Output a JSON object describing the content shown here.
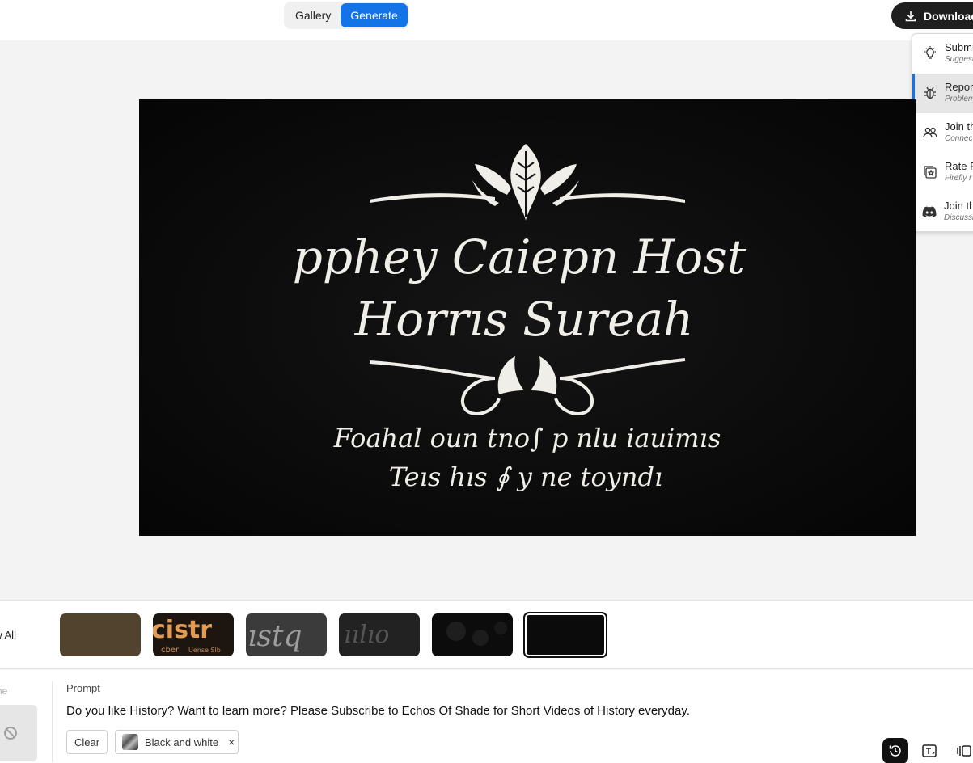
{
  "topbar": {
    "tabs": [
      {
        "label": "Gallery",
        "active": false
      },
      {
        "label": "Generate",
        "active": true
      }
    ],
    "download_label": "Download"
  },
  "menu": {
    "items": [
      {
        "title": "Submi",
        "subtitle": "Suggest",
        "icon": "lightbulb-icon"
      },
      {
        "title": "Repor",
        "subtitle": "Problem",
        "icon": "bug-icon"
      },
      {
        "title": "Join th",
        "subtitle": "Connec",
        "icon": "community-icon"
      },
      {
        "title": "Rate F",
        "subtitle": "Firefly r",
        "icon": "star-badge-icon"
      },
      {
        "title": "Join th",
        "subtitle": "Discussi",
        "icon": "discord-icon"
      }
    ]
  },
  "canvas": {
    "text_lines": [
      "pphey Caiepn Host",
      "Horrıs Sureah",
      "Foahal oun tno∫ p nlu iauimıs",
      "Teıs hıs ∮ y ne toyndı"
    ]
  },
  "thumbnails": {
    "view_all_label": "ew All",
    "items": [
      {
        "name": "thumb-brown",
        "selected": false
      },
      {
        "name": "thumb-cistro",
        "selected": false,
        "caption": "cistr",
        "subcaption": "cber",
        "subcaption2": "Uense Slb"
      },
      {
        "name": "thumb-script-gray",
        "selected": false,
        "caption": "ıstq"
      },
      {
        "name": "thumb-script-dark",
        "selected": false,
        "caption": "ıılıo"
      },
      {
        "name": "thumb-black-blotch",
        "selected": false
      },
      {
        "name": "thumb-black",
        "selected": true
      }
    ]
  },
  "prompt": {
    "left_label": "ne",
    "label": "Prompt",
    "text": "Do you like History? Want to learn more? Please Subscribe to Echos Of Shade for Short Videos of History everyday.",
    "clear_label": "Clear",
    "style_chip_label": "Black and white",
    "style_chip_close": "×"
  },
  "colors": {
    "accent": "#1473e6",
    "download_bg": "#1f1f1f",
    "canvas_bg": "#0b0b0b"
  }
}
